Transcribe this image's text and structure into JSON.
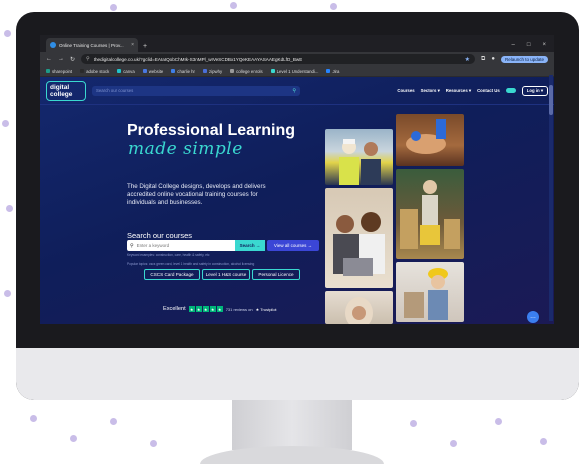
{
  "browser": {
    "tab_title": "Online Training Courses | Prov...",
    "tab_close": "×",
    "new_tab": "+",
    "win_min": "–",
    "win_max": "□",
    "win_close": "×",
    "url": "thedigitalcollege.co.uk/?gclid=EAIaIQobChMIk-S3nMPl_wIVeSCDBx1YQeKEAAYASAAEgKdLfD_BwE",
    "relaunch": "Relaunch to update",
    "bookmarks": [
      {
        "label": "sharepoint",
        "color": "#1e9c8a"
      },
      {
        "label": "adobe stock",
        "color": "#2a2a2a"
      },
      {
        "label": "canva",
        "color": "#20c4cb"
      },
      {
        "label": "website",
        "color": "#4a78e0"
      },
      {
        "label": "charlie hr",
        "color": "#3f7fe8"
      },
      {
        "label": "zipwhy",
        "color": "#4b6fd8"
      },
      {
        "label": "college enrols",
        "color": "#999999"
      },
      {
        "label": "Level 1 Understandi...",
        "color": "#3ad8d0"
      },
      {
        "label": "Jira",
        "color": "#2684ff"
      }
    ]
  },
  "site": {
    "logo_line1": "digital",
    "logo_line2": "college",
    "search_placeholder": "Search our courses",
    "nav": [
      "Courses",
      "Sectors ▾",
      "Resources ▾",
      "Contact Us"
    ],
    "login": "Log in ▾",
    "hero_title": "Professional Learning",
    "hero_script": "made simple",
    "hero_copy": "The Digital College designs, develops and delivers accredited online vocational training courses for individuals and businesses.",
    "course_search_title": "Search our courses",
    "course_search_placeholder": "Enter a keyword",
    "search_button": "Search →",
    "view_all_button": "View all courses →",
    "popular_line1": "Keyword examples: construction, care, health & safety, etc",
    "popular_line2": "Popular topics: cscs green card, level 1 health and safety in construction, alcohol licensing",
    "chips": [
      "CSCS Card Package",
      "Level 1 H&S course",
      "Personal Licence"
    ],
    "trust_excellent": "Excellent",
    "trust_reviews": "731 reviews on",
    "trust_brand": "★ Trustpilot"
  },
  "colors": {
    "navy": "#0f1e5a",
    "teal": "#3ad8d0",
    "blue_button": "#3b46d6",
    "trustpilot_green": "#00b67a"
  }
}
